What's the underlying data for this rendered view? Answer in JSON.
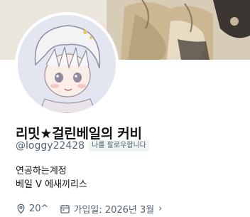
{
  "profile": {
    "display_name": "리밋★걸린베일의 커비",
    "handle": "@loggy22428",
    "follows_you_badge": "나를 팔로우합니다",
    "bio_lines": [
      "연공하는계정",
      "베일 V 에새끼리스"
    ]
  },
  "meta": {
    "location": "20^",
    "joined": "가입일: 2026년 3월",
    "location_icon": "location-pin-icon",
    "calendar_icon": "calendar-icon",
    "chevron_icon": "chevron-right-icon"
  },
  "colors": {
    "text_primary": "#0f1419",
    "text_secondary": "#536471",
    "badge_bg": "#eff3f4"
  }
}
